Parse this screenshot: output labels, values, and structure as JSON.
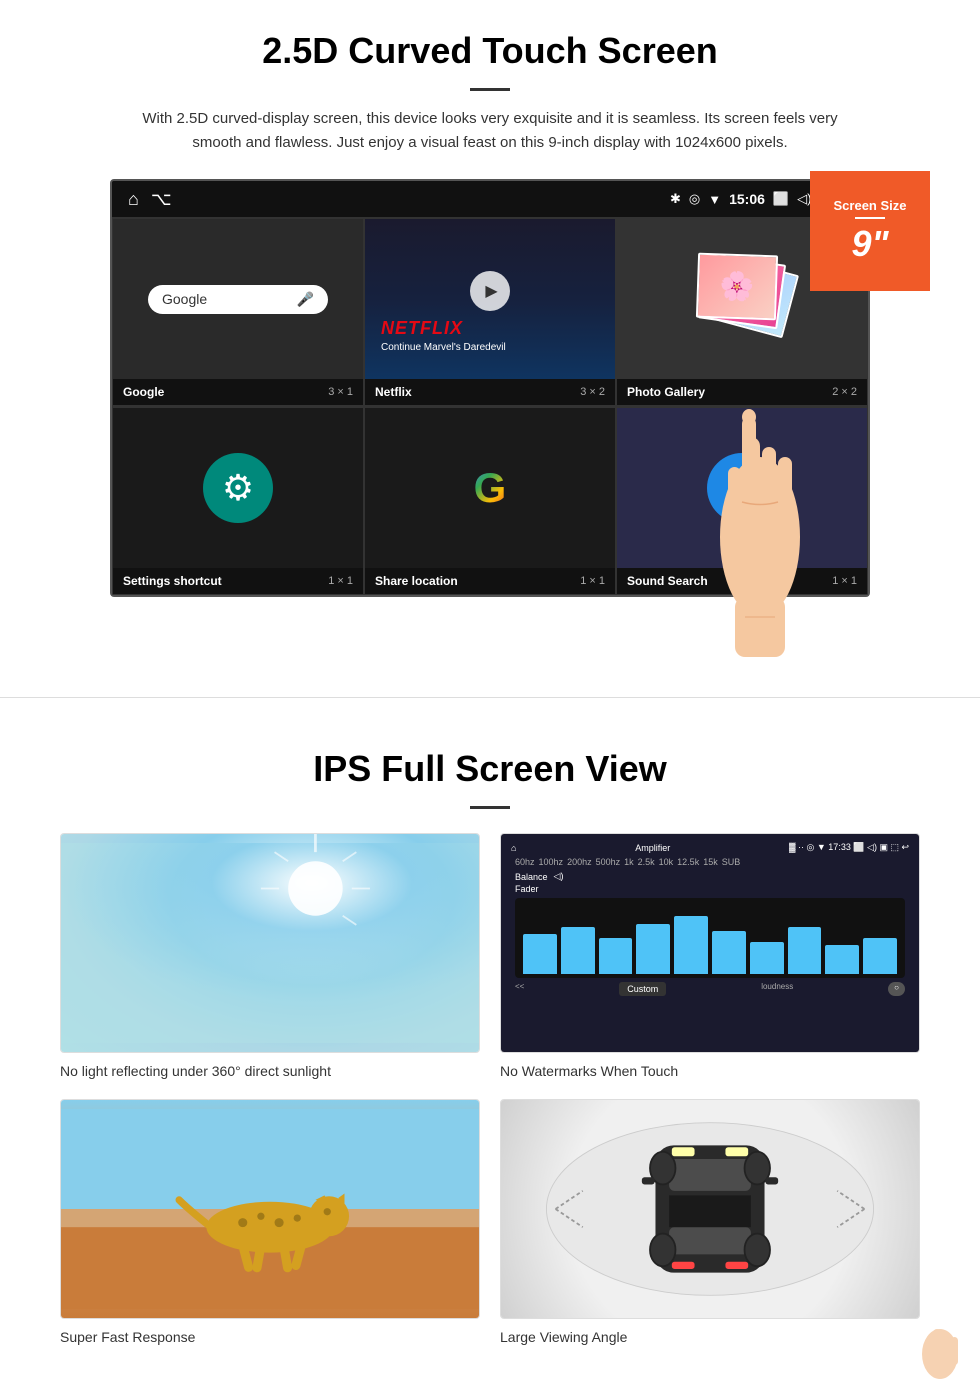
{
  "section1": {
    "title": "2.5D Curved Touch Screen",
    "description": "With 2.5D curved-display screen, this device looks very exquisite and it is seamless. Its screen feels very smooth and flawless. Just enjoy a visual feast on this 9-inch display with 1024x600 pixels.",
    "screen_badge_label": "Screen Size",
    "screen_badge_size": "9\"",
    "status_bar": {
      "time": "15:06"
    },
    "apps": [
      {
        "name": "Google",
        "grid": "3 × 1",
        "type": "google"
      },
      {
        "name": "Netflix",
        "grid": "3 × 2",
        "type": "netflix"
      },
      {
        "name": "Photo Gallery",
        "grid": "2 × 2",
        "type": "photo"
      },
      {
        "name": "Settings shortcut",
        "grid": "1 × 1",
        "type": "settings"
      },
      {
        "name": "Share location",
        "grid": "1 × 1",
        "type": "maps"
      },
      {
        "name": "Sound Search",
        "grid": "1 × 1",
        "type": "music"
      }
    ],
    "netflix_text": "NETFLIX",
    "netflix_subtitle": "Continue Marvel's Daredevil"
  },
  "section2": {
    "title": "IPS Full Screen View",
    "images": [
      {
        "caption": "No light reflecting under 360° direct sunlight",
        "type": "sunlight"
      },
      {
        "caption": "No Watermarks When Touch",
        "type": "equalizer"
      },
      {
        "caption": "Super Fast Response",
        "type": "cheetah"
      },
      {
        "caption": "Large Viewing Angle",
        "type": "car"
      }
    ],
    "eq_labels": [
      "60hz",
      "100hz",
      "200hz",
      "500hz",
      "1k",
      "2.5k",
      "10k",
      "12.5k",
      "15k",
      "SUB"
    ],
    "eq_bar_heights": [
      60,
      70,
      55,
      75,
      85,
      65,
      50,
      70,
      45,
      55
    ]
  }
}
